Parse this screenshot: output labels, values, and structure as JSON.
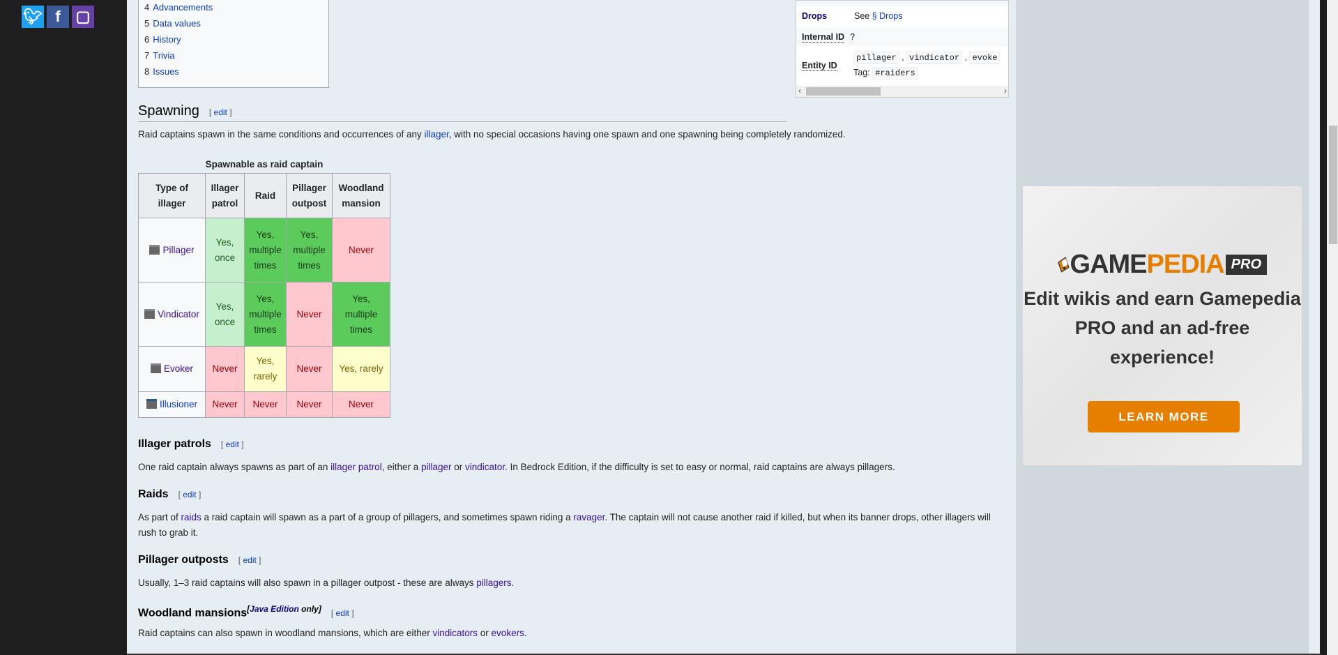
{
  "social": {
    "twitter": "twitter-icon",
    "facebook": "facebook-icon",
    "twitch": "twitch-icon"
  },
  "toc": [
    {
      "num": "4",
      "label": "Advancements"
    },
    {
      "num": "5",
      "label": "Data values"
    },
    {
      "num": "6",
      "label": "History"
    },
    {
      "num": "7",
      "label": "Trivia"
    },
    {
      "num": "8",
      "label": "Issues"
    }
  ],
  "infobox": {
    "drops_label": "Drops",
    "drops_prefix": "See",
    "drops_link": "§ Drops",
    "internal_label": "Internal ID",
    "internal_value": "?",
    "entity_label": "Entity ID",
    "entity_ids": [
      "pillager",
      "vindicator",
      "evoke"
    ],
    "tag_label": "Tag:",
    "tag": "#raiders"
  },
  "edit": "edit",
  "spawning": {
    "title": "Spawning",
    "text_a": "Raid captains spawn in the same conditions and occurrences of any ",
    "link": "illager",
    "text_b": ", with no special occasions having one spawn and one spawning being completely randomized."
  },
  "table": {
    "caption": "Spawnable as raid captain",
    "headers": [
      "Type of illager",
      "Illager patrol",
      "Raid",
      "Pillager outpost",
      "Woodland mansion"
    ],
    "rows": [
      {
        "name": "Pillager",
        "cells": [
          "Yes, once",
          "Yes, multiple times",
          "Yes, multiple times",
          "Never"
        ]
      },
      {
        "name": "Vindicator",
        "cells": [
          "Yes, once",
          "Yes, multiple times",
          "Never",
          "Yes, multiple times"
        ]
      },
      {
        "name": "Evoker",
        "cells": [
          "Never",
          "Yes, rarely",
          "Never",
          "Yes, rarely"
        ]
      },
      {
        "name": "Illusioner",
        "cells": [
          "Never",
          "Never",
          "Never",
          "Never"
        ]
      }
    ]
  },
  "patrols": {
    "title": "Illager patrols",
    "t1": "One raid captain always spawns as part of an ",
    "l1": "illager patrol",
    "t2": ", either a ",
    "l2": "pillager",
    "t3": " or ",
    "l3": "vindicator",
    "t4": ". In Bedrock Edition, if the difficulty is set to easy or normal, raid captains are always pillagers."
  },
  "raids": {
    "title": "Raids",
    "t1": "As part of ",
    "l1": "raids",
    "t2": " a raid captain will spawn as a part of a group of pillagers, and sometimes spawn riding a ",
    "l2": "ravager",
    "t3": ". The captain will not cause another raid if killed, but when its banner drops, other illagers will rush to grab it."
  },
  "outposts": {
    "title": "Pillager outposts",
    "t1": "Usually, 1–3 raid captains will also spawn in a pillager outpost - these are always ",
    "l1": "pillagers",
    "t2": "."
  },
  "mansions": {
    "title": "Woodland mansions",
    "sup_link": "Java Edition",
    "sup_text": " only",
    "t1": "Raid captains can also spawn in woodland mansions, which are either ",
    "l1": "vindicators",
    "t2": " or ",
    "l2": "evokers",
    "t3": "."
  },
  "ad": {
    "logo_a": "GAME",
    "logo_b": "PEDIA",
    "logo_c": "PRO",
    "headline": "Edit wikis and earn Gamepedia PRO and an ad-free experience!",
    "button": "LEARN MORE",
    "colors": {
      "orange": "#e67e00",
      "dark": "#333333"
    }
  }
}
